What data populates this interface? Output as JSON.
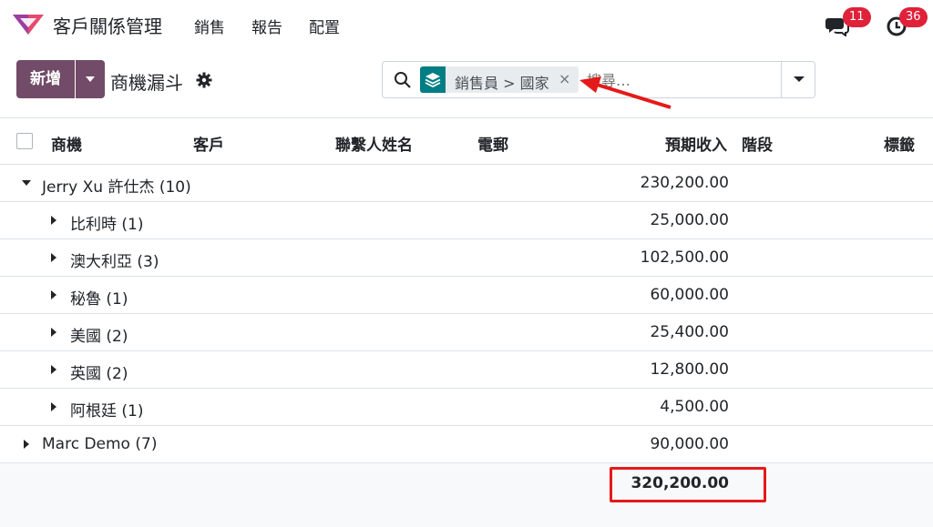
{
  "app": {
    "title": "客戶關係管理",
    "logo_color": "#e54b6f"
  },
  "menu": [
    "銷售",
    "報告",
    "配置"
  ],
  "systray": {
    "messages_count": "11",
    "activities_count": "36"
  },
  "control": {
    "new_label": "新增",
    "breadcrumb": "商機漏斗"
  },
  "search": {
    "facet_values": "銷售員 > 國家",
    "facet_close": "×",
    "placeholder": "搜尋…"
  },
  "table": {
    "columns": [
      "商機",
      "客戶",
      "聯繫人姓名",
      "電郵",
      "預期收入",
      "階段",
      "標籤"
    ],
    "groups": [
      {
        "label": "Jerry Xu 許仕杰 (10)",
        "amount": "230,200.00",
        "expanded": true,
        "level": 0
      },
      {
        "label": "比利時 (1)",
        "amount": "25,000.00",
        "expanded": false,
        "level": 1
      },
      {
        "label": "澳大利亞 (3)",
        "amount": "102,500.00",
        "expanded": false,
        "level": 1
      },
      {
        "label": "秘魯 (1)",
        "amount": "60,000.00",
        "expanded": false,
        "level": 1
      },
      {
        "label": "美國 (2)",
        "amount": "25,400.00",
        "expanded": false,
        "level": 1
      },
      {
        "label": "英國 (2)",
        "amount": "12,800.00",
        "expanded": false,
        "level": 1
      },
      {
        "label": "阿根廷 (1)",
        "amount": "4,500.00",
        "expanded": false,
        "level": 1
      },
      {
        "label": "Marc Demo (7)",
        "amount": "90,000.00",
        "expanded": false,
        "level": 0
      }
    ],
    "total": "320,200.00"
  },
  "colors": {
    "primary": "#714b67",
    "facet": "#017e84",
    "badge": "#e0213a",
    "annotation": "#e41a1a"
  }
}
